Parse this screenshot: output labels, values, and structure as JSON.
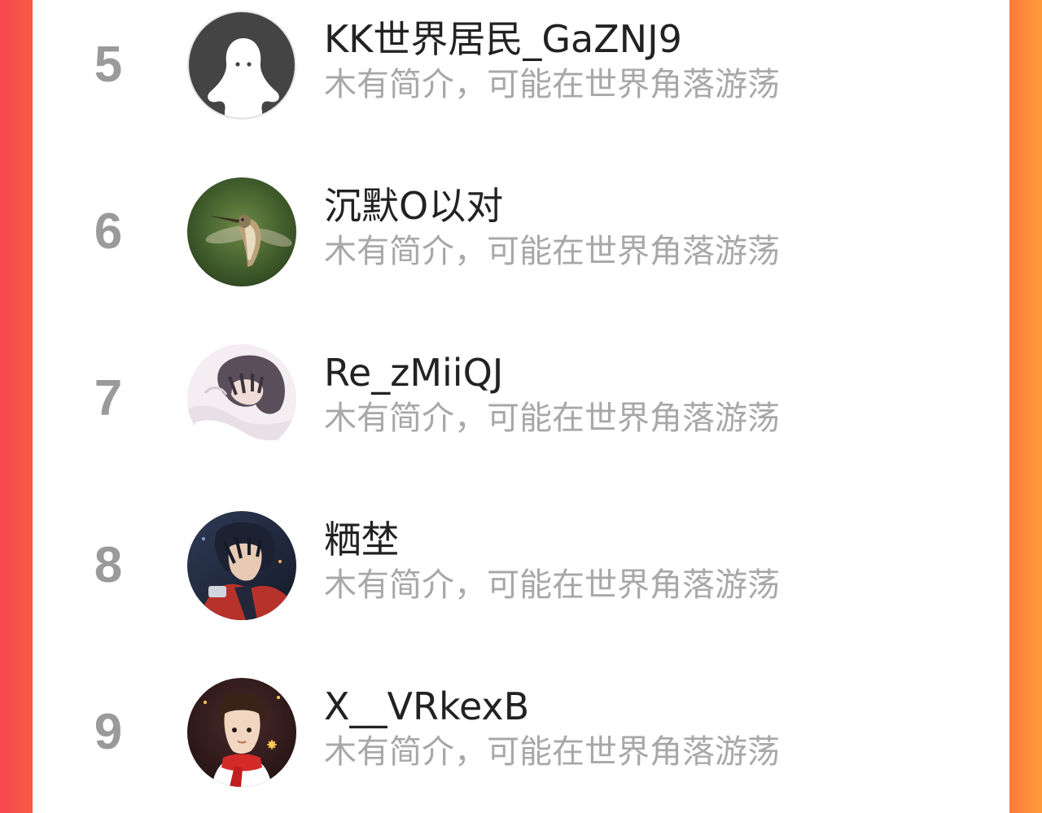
{
  "users": [
    {
      "rank": "5",
      "name": "KK世界居民_GaZNJ9",
      "bio": "木有简介，可能在世界角落游荡",
      "avatar": "default-ghost-avatar"
    },
    {
      "rank": "6",
      "name": "沉默O以对",
      "bio": "木有简介，可能在世界角落游荡",
      "avatar": "hummingbird-photo-avatar"
    },
    {
      "rank": "7",
      "name": "Re_zMiiQJ",
      "bio": "木有简介，可能在世界角落游荡",
      "avatar": "anime-sleeping-boy-avatar"
    },
    {
      "rank": "8",
      "name": "粞埜",
      "bio": "木有简介，可能在世界角落游荡",
      "avatar": "anime-man-scarf-avatar"
    },
    {
      "rank": "9",
      "name": "X__VRkexB",
      "bio": "木有简介，可能在世界角落游荡",
      "avatar": "cartoon-boy-red-scarf-avatar"
    }
  ],
  "colors": {
    "background_left": "#f7474f",
    "background_right": "#fe9b3a",
    "rank": "#9a9a9a",
    "name": "#222222",
    "bio": "#a8a8a8"
  }
}
